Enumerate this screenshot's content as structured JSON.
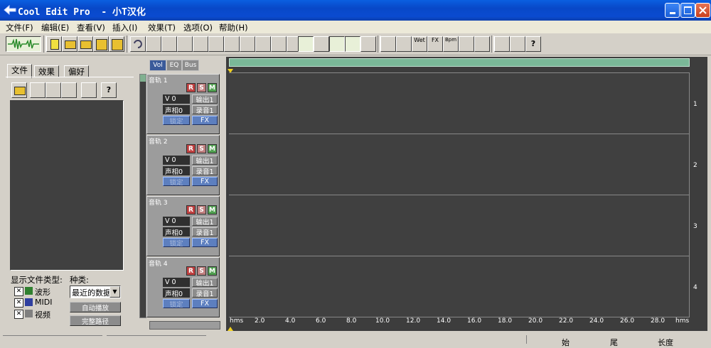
{
  "window": {
    "title": "Cool Edit Pro  - 小T汉化",
    "controls": [
      "minimize-icon",
      "maximize-icon",
      "close-icon"
    ]
  },
  "menu": [
    {
      "label": "文件(F)"
    },
    {
      "label": "编辑(E)"
    },
    {
      "label": "查看(V)"
    },
    {
      "label": "插入(I)"
    },
    {
      "label": "效果(T)"
    },
    {
      "label": "选项(O)"
    },
    {
      "label": "帮助(H)"
    }
  ],
  "toolbar": {
    "fx_labels": [
      "Wet",
      "FX",
      "Bpm"
    ]
  },
  "left_panel": {
    "tabs": [
      "文件",
      "效果",
      "偏好"
    ],
    "show_types_label": "显示文件类型:",
    "kind_label": "种类:",
    "filters": [
      "波形",
      "MIDI",
      "视频"
    ],
    "kind_select": "最近的数据",
    "autoplay_button": "自动播放",
    "full_path_button": "完整路径"
  },
  "track_panel": {
    "tabs": [
      "Vol",
      "EQ",
      "Bus"
    ],
    "tracks": [
      {
        "name": "音轨 1",
        "volume": "V 0",
        "pan": "声相0",
        "output": "输出1",
        "record": "录音1",
        "lock": "锁定",
        "fx": "FX"
      },
      {
        "name": "音轨 2",
        "volume": "V 0",
        "pan": "声相0",
        "output": "输出1",
        "record": "录音1",
        "lock": "锁定",
        "fx": "FX"
      },
      {
        "name": "音轨 3",
        "volume": "V 0",
        "pan": "声相0",
        "output": "输出1",
        "record": "录音1",
        "lock": "锁定",
        "fx": "FX"
      },
      {
        "name": "音轨 4",
        "volume": "V 0",
        "pan": "声相0",
        "output": "输出1",
        "record": "录音1",
        "lock": "锁定",
        "fx": "FX"
      }
    ],
    "rsm": [
      "R",
      "S",
      "M"
    ]
  },
  "timeline": {
    "lane_numbers": [
      "1",
      "2",
      "3",
      "4"
    ],
    "ruler": [
      "hms",
      "2.0",
      "4.0",
      "6.0",
      "8.0",
      "10.0",
      "12.0",
      "14.0",
      "16.0",
      "18.0",
      "20.0",
      "22.0",
      "24.0",
      "26.0",
      "28.0",
      "hms"
    ]
  },
  "status": {
    "labels": [
      "始",
      "尾",
      "长度"
    ]
  },
  "colors": {
    "title_bar": "#0a5fe0",
    "track_area": "#404040",
    "record_button": "#c04040",
    "solo_button": "#c08080",
    "mute_button": "#50a050",
    "scroll_bar": "#7ab898"
  }
}
